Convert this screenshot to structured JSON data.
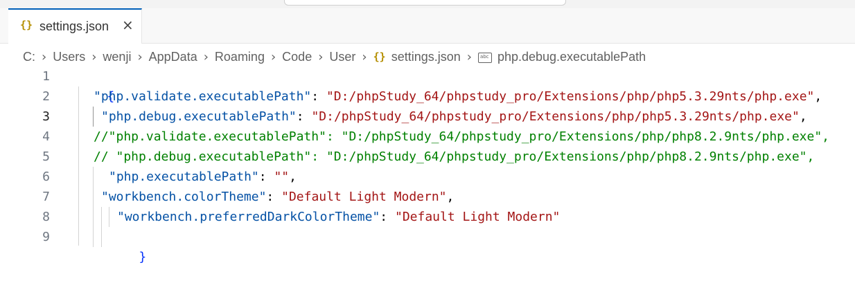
{
  "tab": {
    "icon": "json-braces-icon",
    "braces": "{}",
    "title": "settings.json",
    "close": "×"
  },
  "breadcrumb": {
    "items": [
      "C:",
      "Users",
      "wenji",
      "AppData",
      "Roaming",
      "Code",
      "User"
    ],
    "file": "settings.json",
    "symbol": "php.debug.executablePath",
    "separator": "›",
    "icons": [
      "json-braces-icon",
      "string-symbol-icon"
    ]
  },
  "editor": {
    "active_line": 3,
    "lines": [
      {
        "number": "1",
        "open": "{"
      },
      {
        "number": "2",
        "key": "\"php.validate.executablePath\"",
        "colon": ": ",
        "value": "\"D:/phpStudy_64/phpstudy_pro/Extensions/php/php5.3.29nts/php.exe\"",
        "tail": ","
      },
      {
        "number": "3",
        "key": "\"php.debug.executablePath\"",
        "colon": ": ",
        "value": "\"D:/phpStudy_64/phpstudy_pro/Extensions/php/php5.3.29nts/php.exe\"",
        "tail": ","
      },
      {
        "number": "4",
        "comment": "//\"php.validate.executablePath\": \"D:/phpStudy_64/phpstudy_pro/Extensions/php/php8.2.9nts/php.exe\","
      },
      {
        "number": "5",
        "comment": "// \"php.debug.executablePath\": \"D:/phpStudy_64/phpstudy_pro/Extensions/php/php8.2.9nts/php.exe\","
      },
      {
        "number": "6",
        "key": "\"php.executablePath\"",
        "colon": ": ",
        "value": "\"\"",
        "tail": ","
      },
      {
        "number": "7",
        "key": "\"workbench.colorTheme\"",
        "colon": ": ",
        "value": "\"Default Light Modern\"",
        "tail": ","
      },
      {
        "number": "8",
        "key": "\"workbench.preferredDarkColorTheme\"",
        "colon": ": ",
        "value": "\"Default Light Modern\"",
        "tail": ""
      },
      {
        "number": "9",
        "close": "}"
      }
    ]
  },
  "colors": {
    "accent": "#005fb8",
    "json_key": "#0451a5",
    "json_string": "#a31515",
    "comment": "#008000",
    "bracket": "#0431fa",
    "line_number": "#6e7681"
  }
}
